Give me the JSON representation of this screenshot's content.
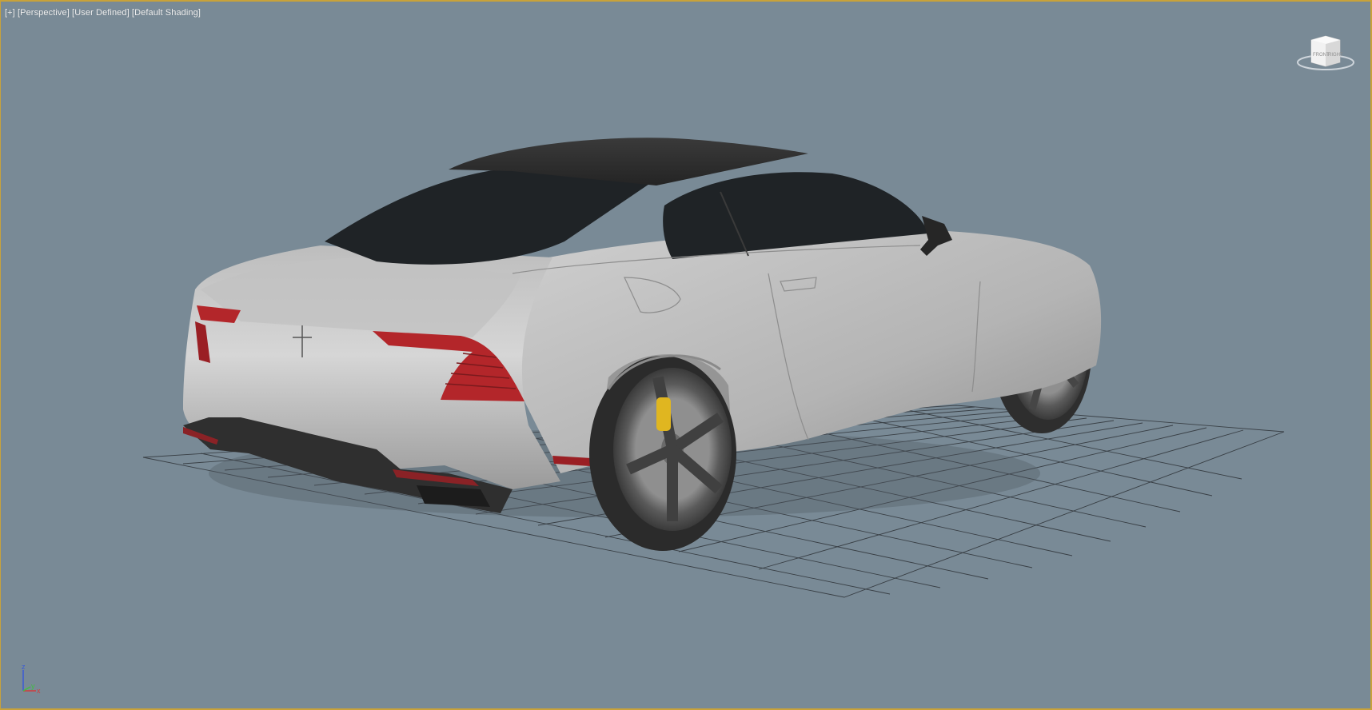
{
  "viewport": {
    "label_parts": [
      "[+]",
      "[Perspective]",
      "[User Defined]",
      "[Default Shading]"
    ],
    "background_color": "#798a96",
    "active_border_color": "#c8a23a"
  },
  "viewcube": {
    "icon": "viewcube-icon",
    "face_front": "FRONT",
    "face_right": "RIGHT"
  },
  "axis_tripod": {
    "icon": "axis-tripod-icon",
    "z": "z",
    "y": "y",
    "x": "x",
    "colors": {
      "x": "#d23b3b",
      "y": "#3fbf3f",
      "z": "#3a5bd6"
    }
  },
  "scene": {
    "object": "car-model",
    "ground_grid": true,
    "paint_color": "#c9c9c9",
    "glass_color": "#1f2326",
    "tail_light_color": "#b3262a",
    "caliper_color": "#e0b620"
  }
}
